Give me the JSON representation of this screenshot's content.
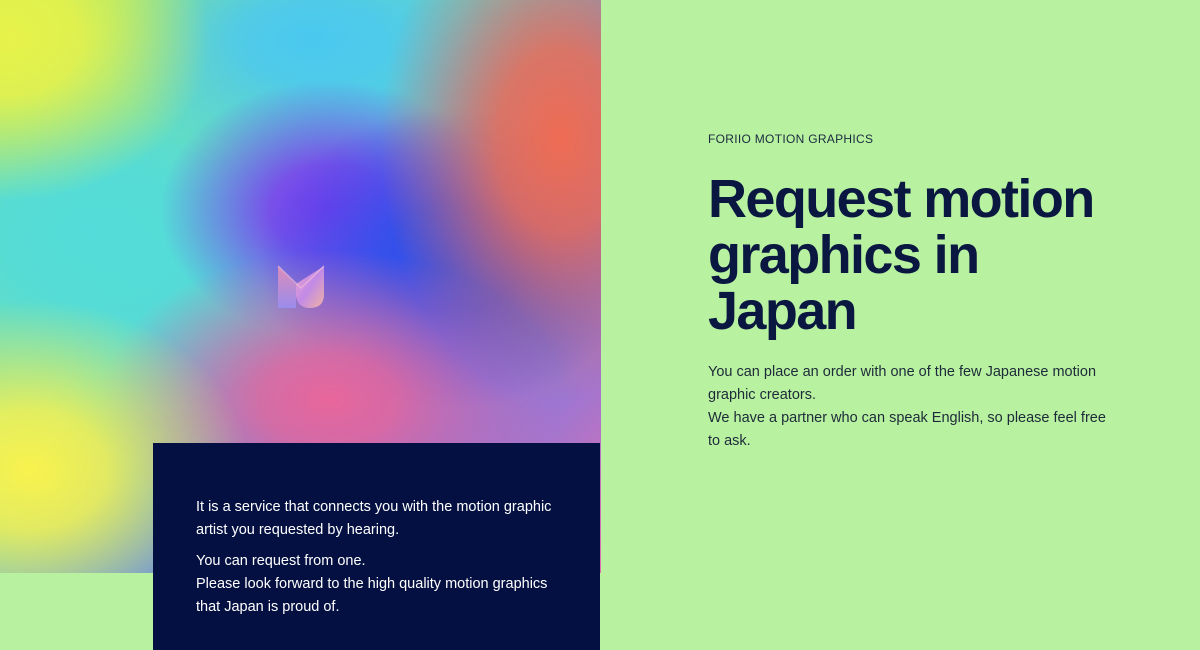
{
  "hero": {
    "logo_icon": "m-logo-icon"
  },
  "info_box": {
    "paragraph_1": "It is a service that connects you with the motion graphic artist you requested by hearing.",
    "paragraph_2_line_1": "You can request from one.",
    "paragraph_2_line_2": "Please look forward to the high quality motion graphics that Japan is proud of."
  },
  "main": {
    "eyebrow": "FORIIO MOTION GRAPHICS",
    "headline": "Request motion graphics in Japan",
    "description_line_1": "You can place an order with one of the few Japanese motion graphic creators.",
    "description_line_2": "We have a partner who can speak English, so please feel free to ask."
  },
  "colors": {
    "background": "#b8f2a0",
    "info_box_bg": "#031041",
    "headline": "#0a1740"
  }
}
